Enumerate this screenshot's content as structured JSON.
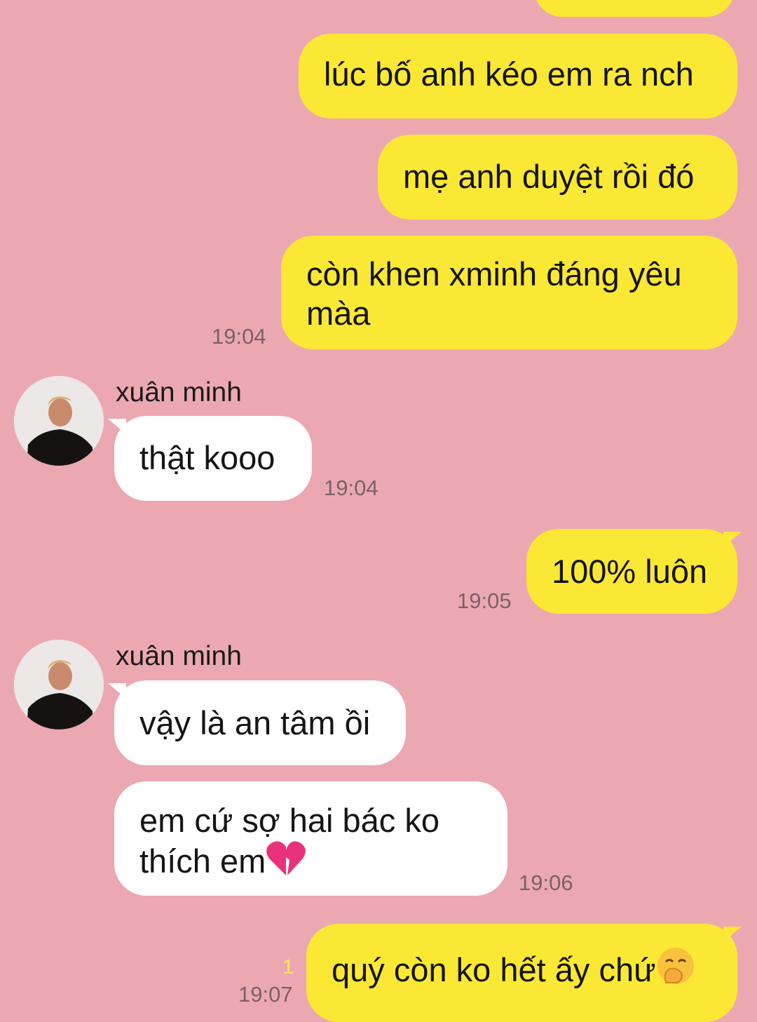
{
  "contact": {
    "name": "xuân minh"
  },
  "messages": [
    {
      "side": "out",
      "text": "lúc bố anh kéo em ra nch"
    },
    {
      "side": "out",
      "text": "mẹ anh duyệt rồi đó"
    },
    {
      "side": "out",
      "line1": "còn khen xminh đáng yêu",
      "line2": "màa",
      "time": "19:04"
    },
    {
      "side": "in",
      "sender": "xuân minh",
      "text": "thật kooo",
      "time": "19:04"
    },
    {
      "side": "out",
      "text": "100% luôn",
      "time": "19:05"
    },
    {
      "side": "in",
      "sender": "xuân minh",
      "text": "vậy là an tâm ồi"
    },
    {
      "side": "in",
      "line1": "em cứ sợ hai bác ko",
      "line2": "thích em",
      "emoji": "broken-heart-icon",
      "time": "19:06"
    },
    {
      "side": "out",
      "text": "quý còn ko hết ấy chứ",
      "emoji": "hand-over-mouth-face-icon",
      "read_count": "1",
      "time": "19:07"
    }
  ],
  "colors": {
    "background": "#eca8b1",
    "outgoing_bubble": "#fbe835",
    "incoming_bubble": "#ffffff",
    "timestamp": "#7a6266",
    "read_indicator": "#f5ea55"
  }
}
